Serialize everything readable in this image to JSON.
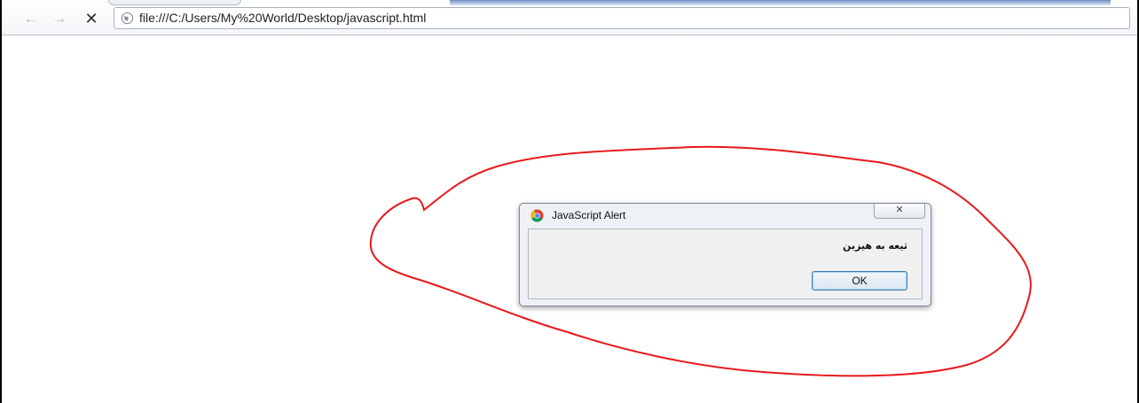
{
  "browser": {
    "url": "file:///C:/Users/My%20World/Desktop/javascript.html",
    "icons": {
      "back": "arrow-left-icon",
      "forward": "arrow-right-icon",
      "stop": "close-icon",
      "page": "globe-icon"
    },
    "nav": {
      "back_glyph": "←",
      "forward_glyph": "→",
      "stop_glyph": "✕"
    }
  },
  "alert": {
    "title": "JavaScript Alert",
    "message": "ثیعه به هیزین",
    "ok_label": "OK",
    "close_glyph": "✕",
    "icon": "chrome-icon"
  },
  "annotation": {
    "color": "#e8191b"
  }
}
